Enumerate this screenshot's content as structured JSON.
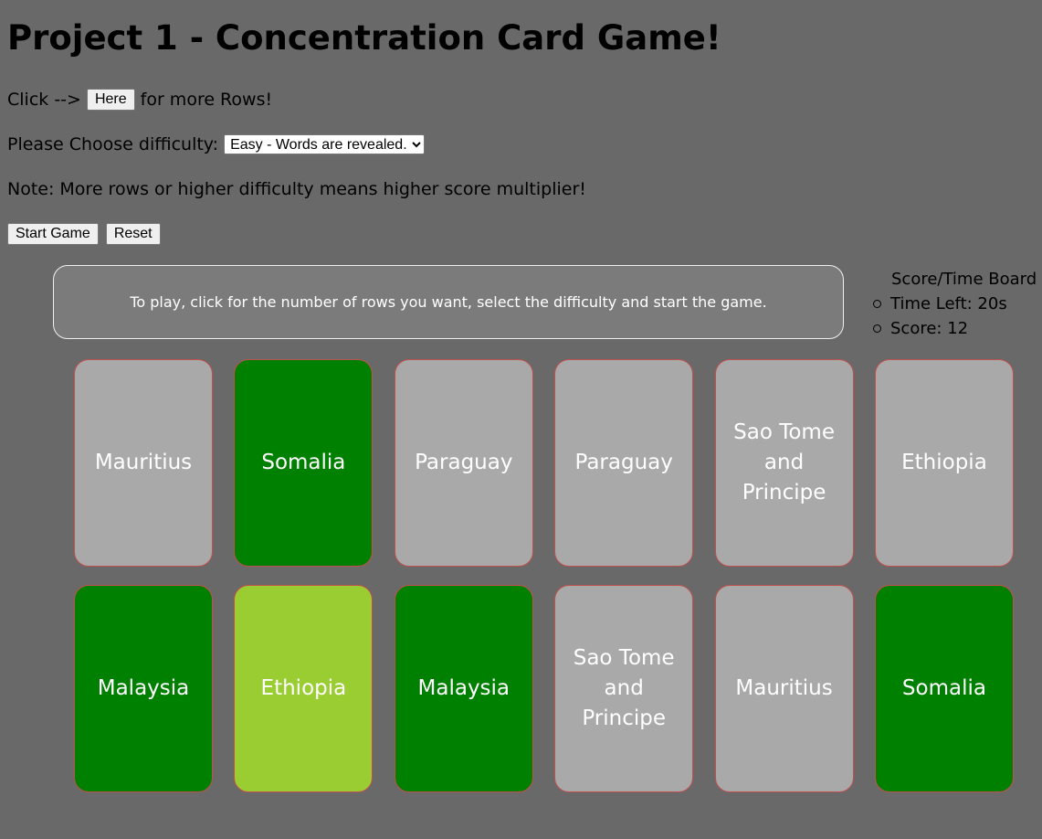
{
  "title": "Project 1 - Concentration Card Game!",
  "rows_line": {
    "prefix": "Click -->",
    "button_label": "Here",
    "suffix": "for more Rows!"
  },
  "difficulty": {
    "label": "Please Choose difficulty:",
    "selected": "Easy - Words are revealed."
  },
  "note": "Note: More rows or higher difficulty means higher score multiplier!",
  "controls": {
    "start_label": "Start Game",
    "reset_label": "Reset"
  },
  "message": "To play, click for the number of rows you want, select the difficulty and start the game.",
  "scoreboard": {
    "title": "Score/Time Board",
    "time_left": "Time Left: 20s",
    "score": "Score: 12"
  },
  "colors": {
    "background": "#696969",
    "card_default": "#a9a9a9",
    "card_matched": "#008000",
    "card_selected": "#9acd32",
    "card_border": "#c0504d"
  },
  "cards": [
    {
      "label": "Mauritius",
      "state": "default"
    },
    {
      "label": "Somalia",
      "state": "matched"
    },
    {
      "label": "Paraguay",
      "state": "default"
    },
    {
      "label": "Paraguay",
      "state": "default"
    },
    {
      "label": "Sao Tome and Principe",
      "state": "default"
    },
    {
      "label": "Ethiopia",
      "state": "default"
    },
    {
      "label": "Malaysia",
      "state": "matched"
    },
    {
      "label": "Ethiopia",
      "state": "selected"
    },
    {
      "label": "Malaysia",
      "state": "matched"
    },
    {
      "label": "Sao Tome and Principe",
      "state": "default"
    },
    {
      "label": "Mauritius",
      "state": "default"
    },
    {
      "label": "Somalia",
      "state": "matched"
    }
  ]
}
